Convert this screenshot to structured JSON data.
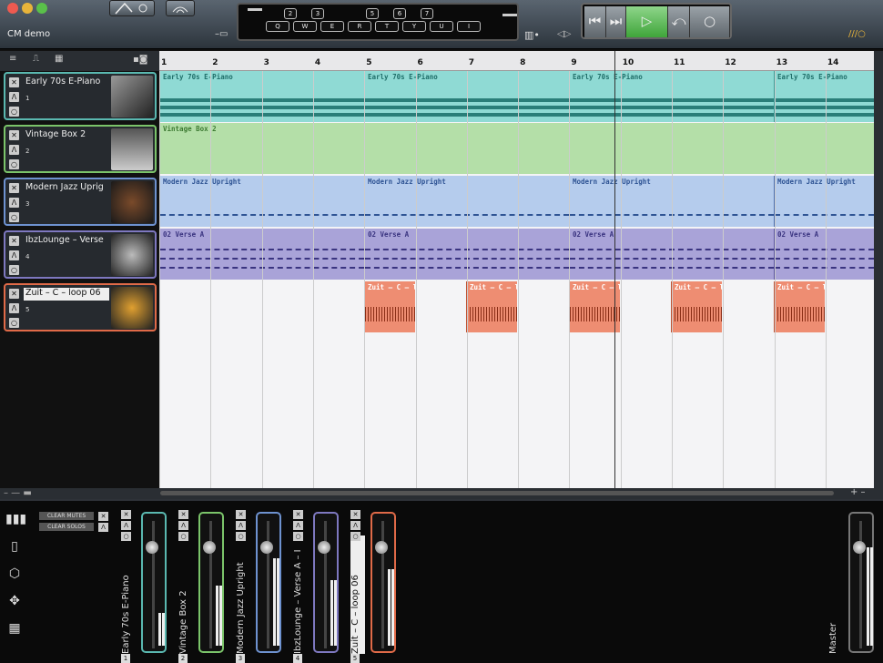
{
  "app": {
    "title": "CM demo"
  },
  "keyboard": {
    "numbers": [
      "2",
      "3",
      "5",
      "6",
      "7"
    ],
    "letters": [
      "Q",
      "W",
      "E",
      "R",
      "T",
      "Y",
      "U",
      "I"
    ]
  },
  "transport": {
    "buttons": [
      "⏮",
      "⏭",
      "▷",
      "⤺",
      "○"
    ]
  },
  "ruler": [
    "1",
    "2",
    "3",
    "4",
    "5",
    "6",
    "7",
    "8",
    "9",
    "10",
    "11",
    "12",
    "13",
    "14"
  ],
  "tracks": [
    {
      "name": "Early 70s E-Piano",
      "num": "1",
      "color": "#6ecfc9",
      "border": "#5cb5ae"
    },
    {
      "name": "Vintage Box 2",
      "num": "2",
      "color": "#96cc8a",
      "border": "#7bb86f"
    },
    {
      "name": "Modern Jazz Uprig",
      "num": "3",
      "color": "#8fb2e0",
      "border": "#6f95cc"
    },
    {
      "name": "IbzLounge – Verse",
      "num": "4",
      "color": "#8e86c7",
      "border": "#7670b5"
    },
    {
      "name": "Zuit – C – loop 06",
      "num": "5",
      "color": "#ee8d72",
      "border": "#e07050"
    }
  ],
  "regions": {
    "epiano": "Early 70s E-Piano",
    "vintage": "Vintage Box 2",
    "jazz": "Modern Jazz Upright",
    "ibz": "02 Verse A",
    "zuit": "Zuit – C – l"
  },
  "mixer": {
    "clear_mutes": "CLEAR MUTES",
    "clear_solos": "CLEAR SOLOS",
    "channels": [
      {
        "name": "Early 70s E-Piano",
        "num": "1",
        "color": "#5ab8b0",
        "level": 0.3
      },
      {
        "name": "Vintage Box 2",
        "num": "2",
        "color": "#7bc46a",
        "level": 0.55
      },
      {
        "name": "Modern Jazz Upright",
        "num": "3",
        "color": "#6e92d0",
        "level": 0.8
      },
      {
        "name": "IbzLounge – Verse A – I",
        "num": "4",
        "color": "#7e78c0",
        "level": 0.6
      },
      {
        "name": "Zuit – C – loop 06",
        "num": "5",
        "color": "#e06a48",
        "level": 0.7
      }
    ],
    "master": "Master"
  },
  "icons": {
    "mixer": "faders-icon",
    "browser": "browser-icon",
    "cube": "cube-icon",
    "move": "move-icon",
    "grid": "grid-icon"
  }
}
